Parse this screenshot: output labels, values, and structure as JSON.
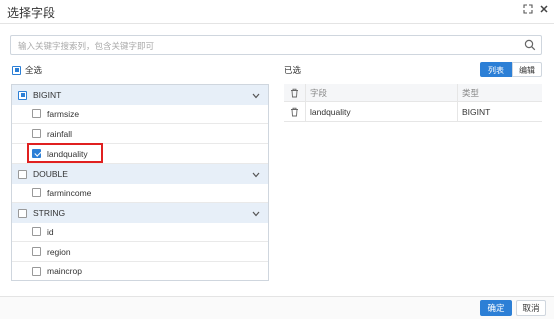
{
  "dialog": {
    "title": "选择字段"
  },
  "search": {
    "placeholder": "输入关键字搜索列，包含关键字即可"
  },
  "select_all": {
    "label": "全选"
  },
  "groups": [
    {
      "label": "BIGINT",
      "state": "partial",
      "fields": [
        {
          "label": "farmsize",
          "checked": false
        },
        {
          "label": "rainfall",
          "checked": false
        },
        {
          "label": "landquality",
          "checked": true
        }
      ]
    },
    {
      "label": "DOUBLE",
      "state": "unchecked",
      "fields": [
        {
          "label": "farmincome",
          "checked": false
        }
      ]
    },
    {
      "label": "STRING",
      "state": "unchecked",
      "fields": [
        {
          "label": "id",
          "checked": false
        },
        {
          "label": "region",
          "checked": false
        },
        {
          "label": "maincrop",
          "checked": false
        }
      ]
    }
  ],
  "selected": {
    "label": "已选",
    "tabs": [
      "列表",
      "编辑"
    ],
    "columns": [
      "字段",
      "类型"
    ],
    "rows": [
      {
        "field": "landquality",
        "type": "BIGINT"
      }
    ]
  },
  "footer": {
    "ok_label": "确定",
    "cancel_label": "取消"
  },
  "colors": {
    "accent": "#2c7fd6",
    "highlight": "#e02020",
    "group_bg": "#e7eff8"
  }
}
